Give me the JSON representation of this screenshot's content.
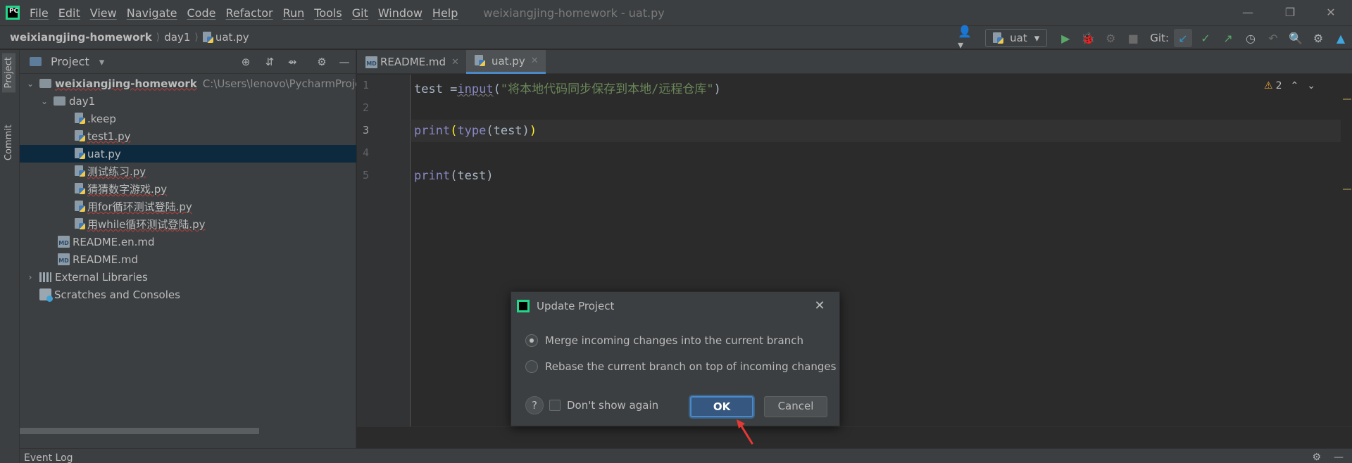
{
  "window": {
    "menu": [
      "File",
      "Edit",
      "View",
      "Navigate",
      "Code",
      "Refactor",
      "Run",
      "Tools",
      "Git",
      "Window",
      "Help"
    ],
    "title": "weixiangjing-homework - uat.py",
    "controls": [
      "minimize-icon",
      "restore-icon",
      "close-icon"
    ]
  },
  "breadcrumb": [
    "weixiangjing-homework",
    "day1",
    "uat.py"
  ],
  "toolbar": {
    "run_config": "uat",
    "git_label": "Git:"
  },
  "left_strip": {
    "project_tab": "Project",
    "commit_tab": "Commit"
  },
  "project_panel": {
    "title": "Project",
    "tree": [
      {
        "name": "weixiangjing-homework",
        "hint": "C:\\Users\\lenovo\\PycharmProjec",
        "type": "folder",
        "expanded": true
      },
      {
        "name": "day1",
        "type": "folder",
        "expanded": true
      },
      {
        "name": ".keep",
        "type": "file"
      },
      {
        "name": "test1.py",
        "type": "py"
      },
      {
        "name": "uat.py",
        "type": "py",
        "selected": true
      },
      {
        "name": "测试练习.py",
        "type": "py"
      },
      {
        "name": "猜猜数字游戏.py",
        "type": "py"
      },
      {
        "name": "用for循环测试登陆.py",
        "type": "py"
      },
      {
        "name": "用while循环测试登陆.py",
        "type": "py"
      },
      {
        "name": "README.en.md",
        "type": "md"
      },
      {
        "name": "README.md",
        "type": "md"
      },
      {
        "name": "External Libraries",
        "type": "lib"
      },
      {
        "name": "Scratches and Consoles",
        "type": "scratch"
      }
    ]
  },
  "editor": {
    "tabs": [
      {
        "label": "README.md",
        "active": false
      },
      {
        "label": "uat.py",
        "active": true
      }
    ],
    "line_numbers": [
      "1",
      "2",
      "3",
      "4",
      "5"
    ],
    "code": {
      "l1_var": "test =",
      "l1_fn": "input",
      "l1_open": "(",
      "l1_str": "\"将本地代码同步保存到本地/远程仓库\"",
      "l1_close": ")",
      "l3_fn": "print",
      "l3_open": "(",
      "l3_inner_fn": "type",
      "l3_arg": "(test)",
      "l3_close": ")",
      "l5_fn": "print",
      "l5_rest": "(test)"
    },
    "inspection_count": "2"
  },
  "dialog": {
    "title": "Update Project",
    "options": [
      {
        "label": "Merge incoming changes into the current branch",
        "selected": true
      },
      {
        "label": "Rebase the current branch on top of incoming changes",
        "selected": false
      }
    ],
    "help": "?",
    "dont_show": "Don't show again",
    "ok": "OK",
    "cancel": "Cancel"
  },
  "bottom": {
    "event_log": "Event Log"
  },
  "colors": {
    "accent": "#4a88c7",
    "selection": "#0d293e",
    "string": "#6a8759",
    "builtin": "#8888c6",
    "annotation_arrow": "#e53935"
  }
}
